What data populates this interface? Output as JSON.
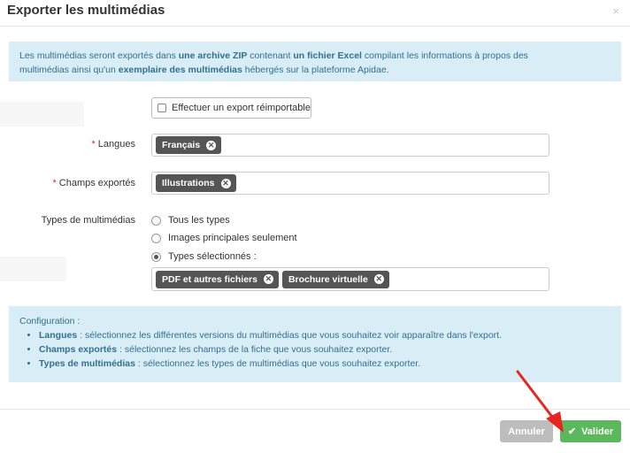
{
  "dialog": {
    "title": "Exporter les multimédias",
    "close_icon": "×"
  },
  "info_box": {
    "t1": "Les multimédias seront exportés dans ",
    "b1": "une archive ZIP",
    "t2": " contenant ",
    "b2": "un fichier Excel",
    "t3": " compilant les informations à propos des",
    "t4": "multimédias ainsi qu'un ",
    "b3": "exemplaire des multimédias",
    "t5": " hébergés sur la plateforme Apidae."
  },
  "reimport": {
    "label": "Effectuer un export réimportable",
    "checked": false
  },
  "fields": {
    "required_mark": "*",
    "langues_label": "Langues",
    "langues_tags": [
      "Français"
    ],
    "champs_label": "Champs exportés",
    "champs_tags": [
      "Illustrations"
    ],
    "types_label": "Types de multimédias",
    "types_options": [
      "Tous les types",
      "Images principales seulement",
      "Types sélectionnés :"
    ],
    "types_selected_index": 2,
    "types_tags": [
      "PDF et autres fichiers",
      "Brochure virtuelle"
    ]
  },
  "config": {
    "title": "Configuration :",
    "items": [
      {
        "key": "Langues",
        "text": " : sélectionnez les différentes versions du multimédias que vous souhaitez voir apparaître dans l'export."
      },
      {
        "key": "Champs exportés",
        "text": " : sélectionnez les champs de la fiche que vous souhaitez exporter."
      },
      {
        "key": "Types de multimédias",
        "text": " : sélectionnez les types de multimédias que vous souhaitez exporter."
      }
    ]
  },
  "footer": {
    "cancel_label": "Annuler",
    "ok_label": "Valider",
    "ok_icon": "check-icon"
  },
  "colors": {
    "info_bg": "#d9edf7",
    "info_text": "#31708f",
    "tag_bg": "#555555",
    "ok_green": "#5cb85c",
    "required_red": "#c9302c",
    "arrow_red": "#e8251e"
  }
}
